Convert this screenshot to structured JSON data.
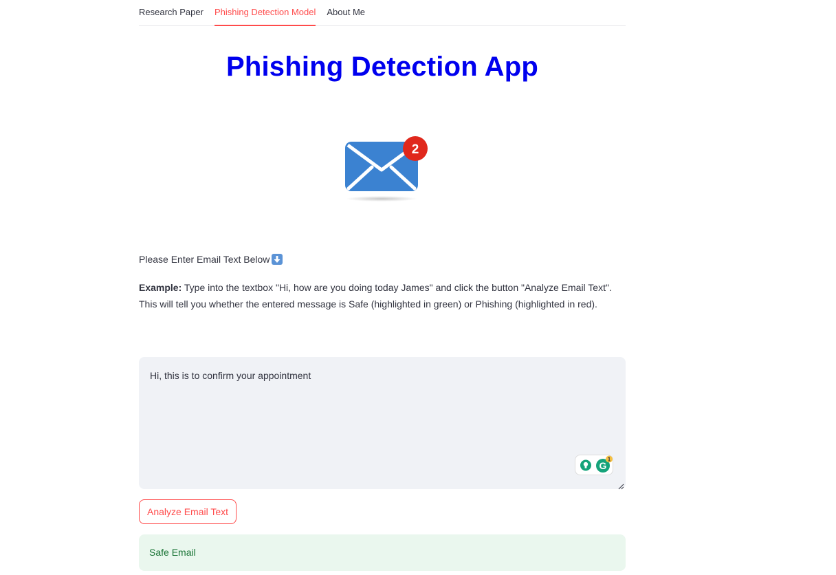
{
  "tabs": [
    {
      "label": "Research Paper",
      "active": false
    },
    {
      "label": "Phishing Detection Model",
      "active": true
    },
    {
      "label": "About Me",
      "active": false
    }
  ],
  "title": "Phishing Detection App",
  "envelope": {
    "icon": "envelope-icon",
    "badge_count": "2",
    "color": "#3b82d1",
    "badge_color": "#e0281c"
  },
  "prompt": {
    "text": "Please Enter Email Text Below",
    "icon": "down-arrow-icon"
  },
  "example": {
    "label": "Example:",
    "text": " Type into the textbox \"Hi, how are you doing today James\" and click the button \"Analyze Email Text\". This will tell you whether the entered message is Safe (highlighted in green) or Phishing (highlighted in red)."
  },
  "email_input": {
    "value": "Hi, this is to confirm your appointment",
    "grammarly_count": "1"
  },
  "analyze_button": {
    "label": "Analyze Email Text"
  },
  "result": {
    "label": "Safe Email",
    "status_color": "#177233",
    "background": "#eaf7ee"
  },
  "colors": {
    "accent": "#ff4b4b",
    "title": "#0000ee"
  }
}
